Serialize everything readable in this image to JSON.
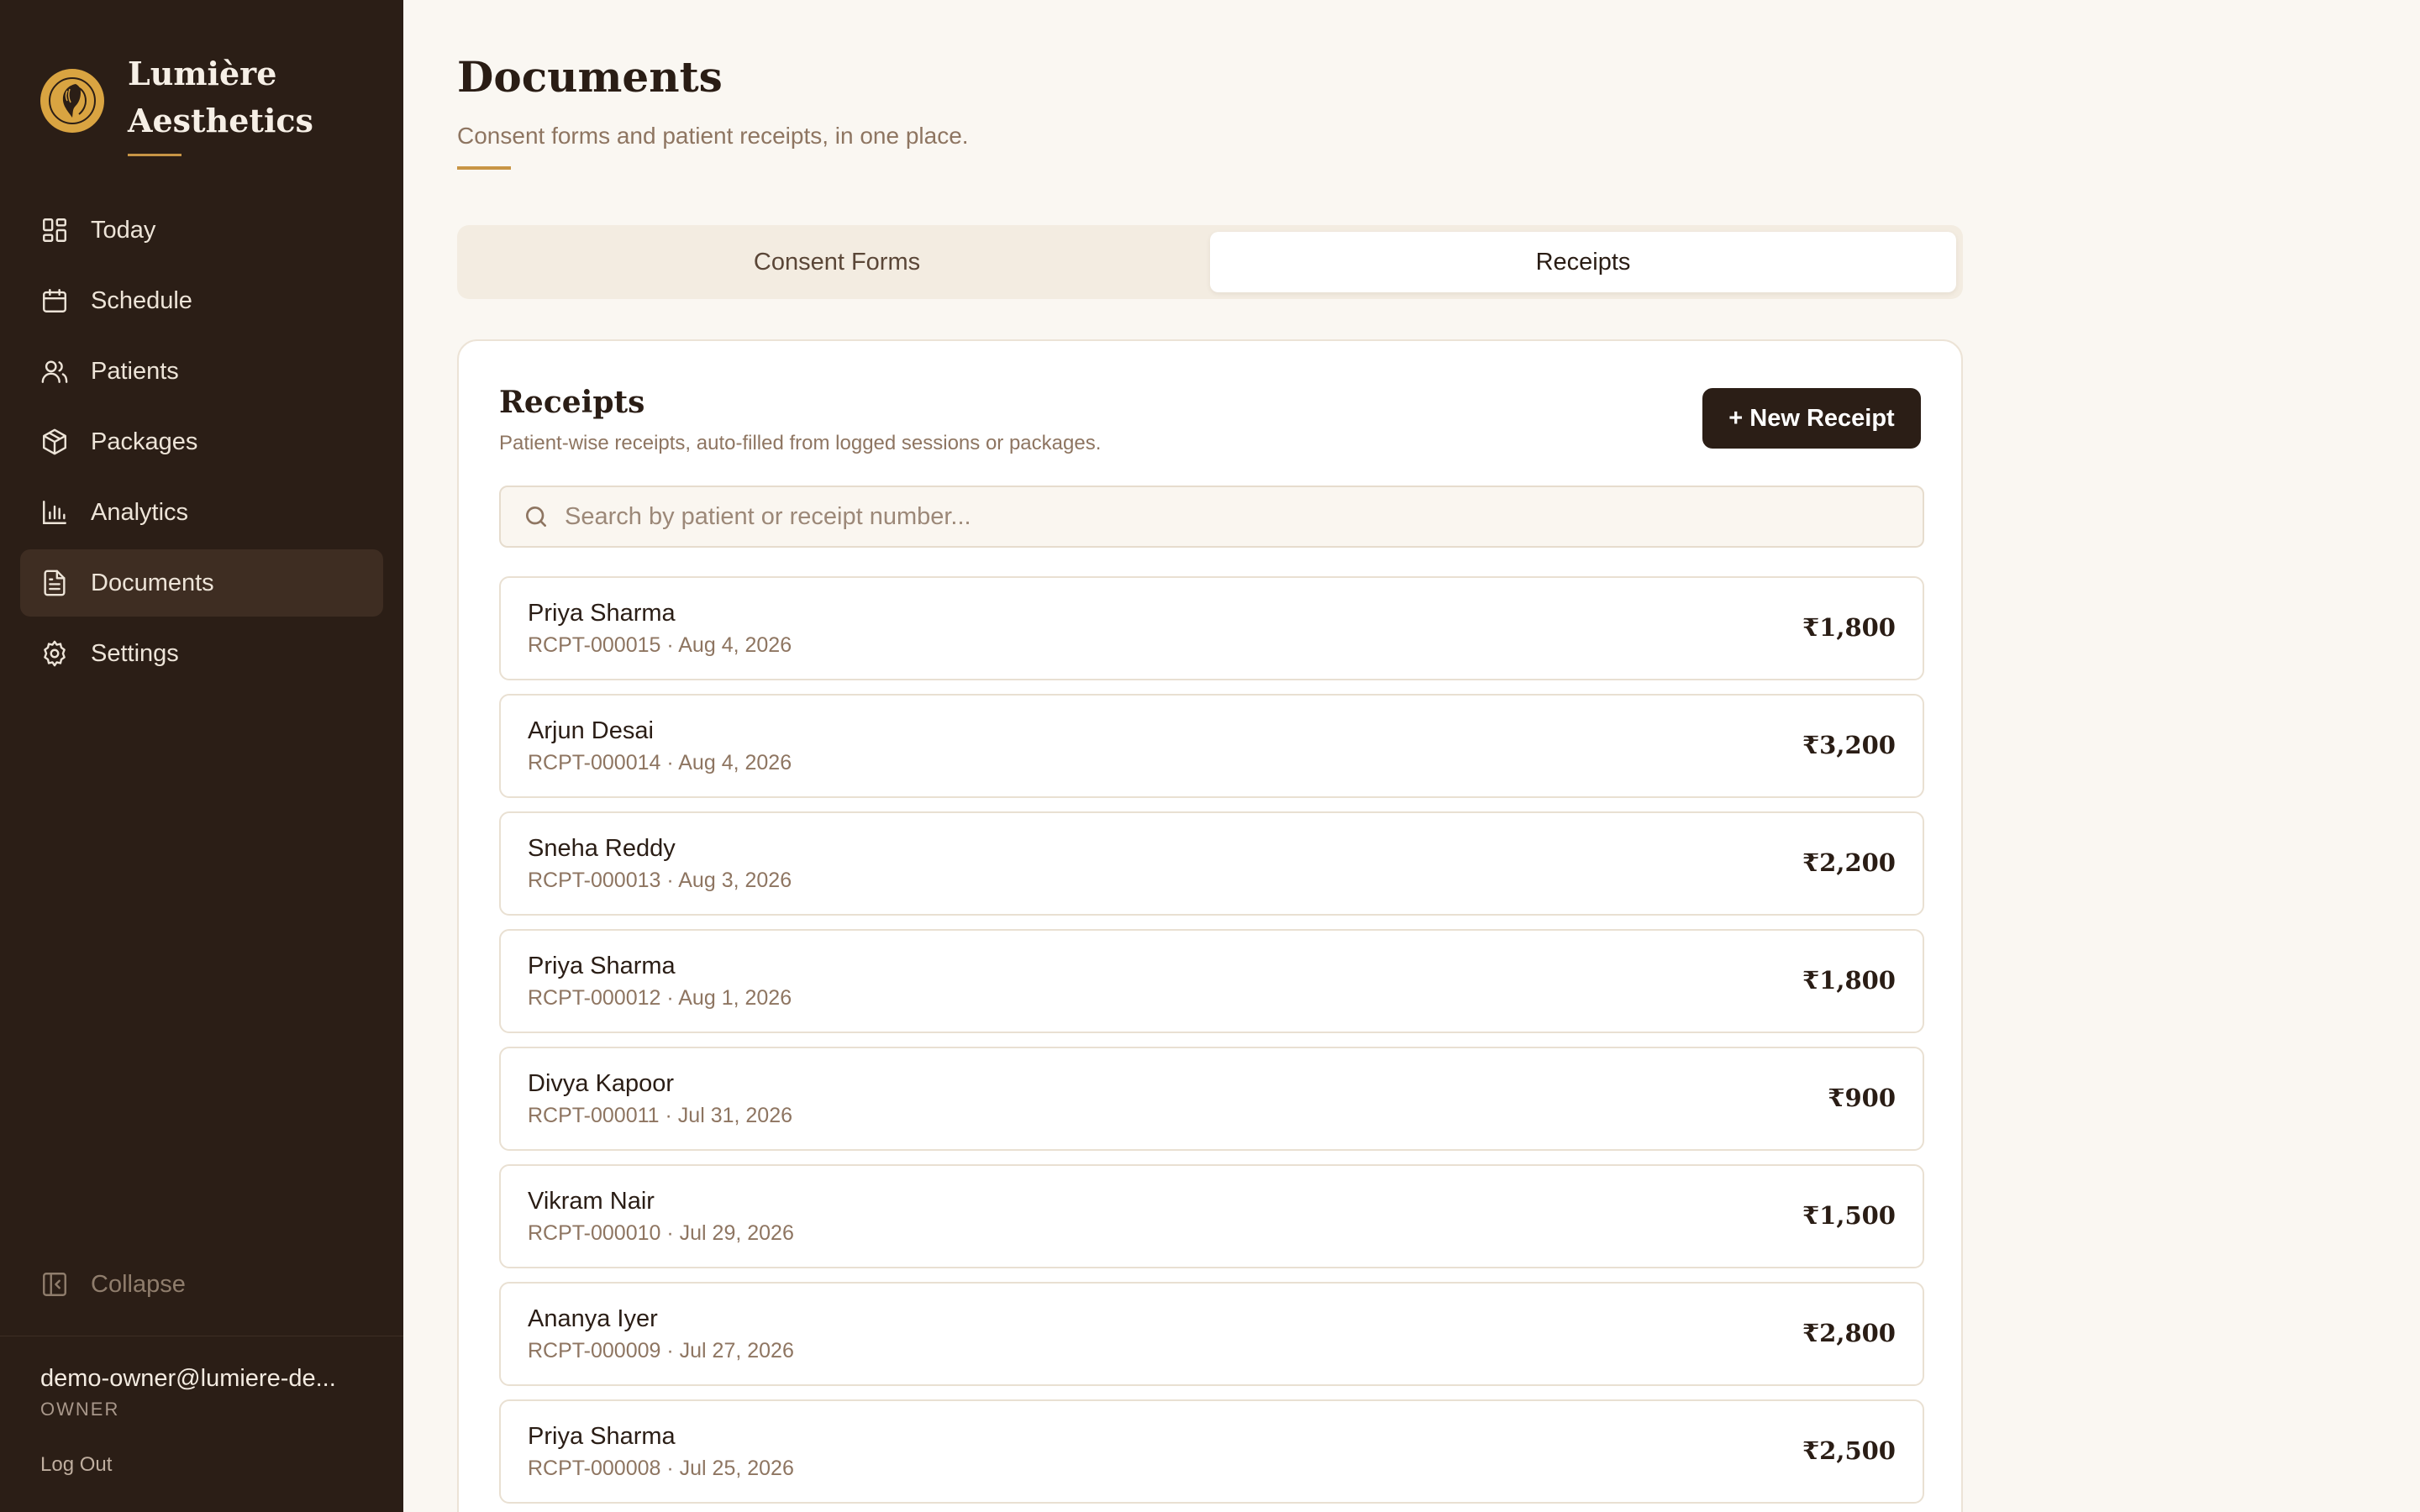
{
  "brand": {
    "name_line1": "Lumière",
    "name_line2": "Aesthetics"
  },
  "sidebar": {
    "items": [
      {
        "label": "Today",
        "icon": "dashboard-icon"
      },
      {
        "label": "Schedule",
        "icon": "calendar-icon"
      },
      {
        "label": "Patients",
        "icon": "users-icon"
      },
      {
        "label": "Packages",
        "icon": "package-icon"
      },
      {
        "label": "Analytics",
        "icon": "bar-chart-icon"
      },
      {
        "label": "Documents",
        "icon": "document-icon",
        "active": true
      },
      {
        "label": "Settings",
        "icon": "gear-icon"
      }
    ],
    "collapse_label": "Collapse",
    "user_email": "demo-owner@lumiere-de...",
    "user_role": "OWNER",
    "logout_label": "Log Out"
  },
  "page": {
    "title": "Documents",
    "subtitle": "Consent forms and patient receipts, in one place."
  },
  "tabs": [
    {
      "label": "Consent Forms",
      "active": false
    },
    {
      "label": "Receipts",
      "active": true
    }
  ],
  "receipts": {
    "title": "Receipts",
    "subtitle": "Patient-wise receipts, auto-filled from logged sessions or packages.",
    "new_button_label": "+ New Receipt",
    "search_placeholder": "Search by patient or receipt number...",
    "rows": [
      {
        "patient": "Priya Sharma",
        "meta": "RCPT-000015 · Aug 4, 2026",
        "amount": "₹1,800"
      },
      {
        "patient": "Arjun Desai",
        "meta": "RCPT-000014 · Aug 4, 2026",
        "amount": "₹3,200"
      },
      {
        "patient": "Sneha Reddy",
        "meta": "RCPT-000013 · Aug 3, 2026",
        "amount": "₹2,200"
      },
      {
        "patient": "Priya Sharma",
        "meta": "RCPT-000012 · Aug 1, 2026",
        "amount": "₹1,800"
      },
      {
        "patient": "Divya Kapoor",
        "meta": "RCPT-000011 · Jul 31, 2026",
        "amount": "₹900"
      },
      {
        "patient": "Vikram Nair",
        "meta": "RCPT-000010 · Jul 29, 2026",
        "amount": "₹1,500"
      },
      {
        "patient": "Ananya Iyer",
        "meta": "RCPT-000009 · Jul 27, 2026",
        "amount": "₹2,800"
      },
      {
        "patient": "Priya Sharma",
        "meta": "RCPT-000008 · Jul 25, 2026",
        "amount": "₹2,500"
      }
    ]
  },
  "colors": {
    "sidebar_bg": "#2b1e16",
    "accent_gold": "#c89545",
    "page_bg": "#faf7f2",
    "primary_button": "#2b1e16"
  }
}
